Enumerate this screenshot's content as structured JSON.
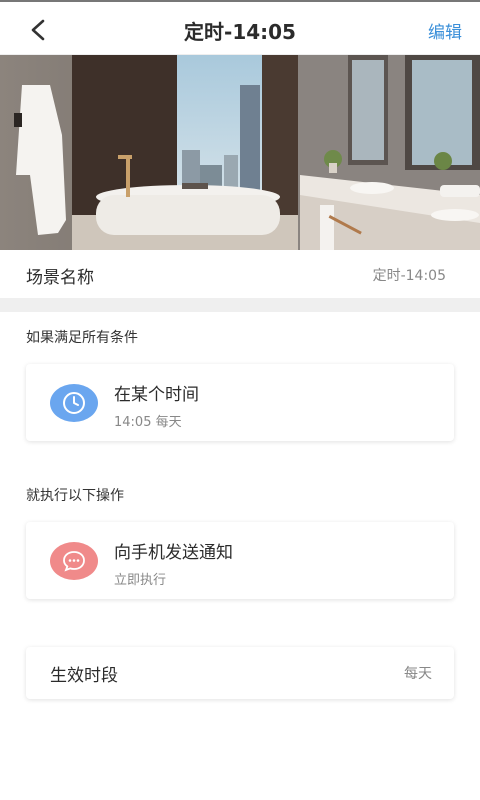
{
  "header": {
    "title": "定时-14:05",
    "edit_label": "编辑",
    "back_icon": "chevron-left-icon"
  },
  "scene": {
    "label": "场景名称",
    "value": "定时-14:05"
  },
  "conditions": {
    "section_title": "如果满足所有条件",
    "items": [
      {
        "title": "在某个时间",
        "subtitle": "14:05 每天",
        "icon": "clock-icon",
        "icon_color": "#6aa6ef"
      }
    ]
  },
  "actions": {
    "section_title": "就执行以下操作",
    "items": [
      {
        "title": "向手机发送通知",
        "subtitle": "立即执行",
        "icon": "chat-bubble-icon",
        "icon_color": "#f08a8a"
      }
    ]
  },
  "period": {
    "label": "生效时段",
    "value": "每天"
  }
}
